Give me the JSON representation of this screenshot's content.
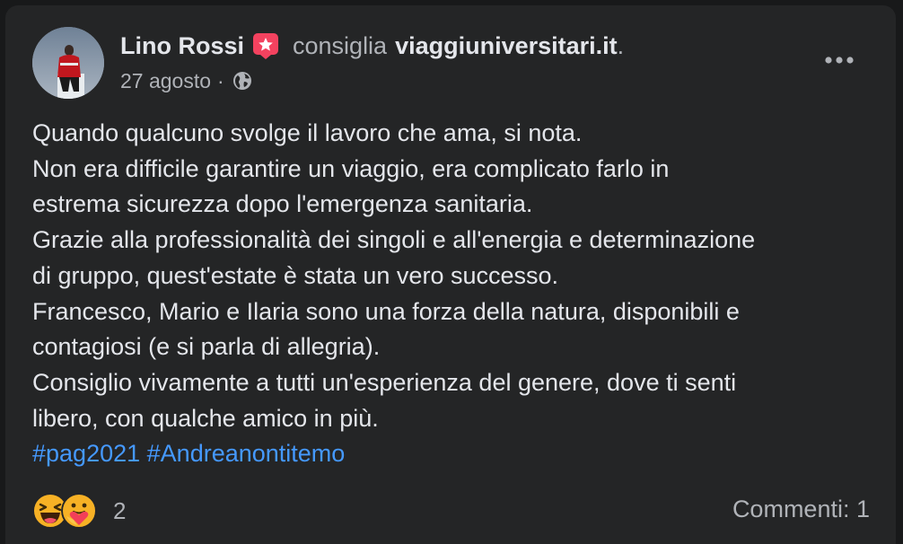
{
  "post": {
    "author": "Lino Rossi",
    "verb": "consiglia",
    "page": "viaggiuniversitari.it",
    "page_suffix": ".",
    "date": "27 agosto",
    "date_separator": "·",
    "privacy_icon": "globe-icon",
    "recommend_icon": "star-badge-icon",
    "more_icon": "more-options-icon",
    "body_lines": [
      "Quando qualcuno svolge il lavoro che ama, si nota.",
      "Non era difficile garantire un viaggio, era complicato farlo in",
      "estrema sicurezza dopo l'emergenza sanitaria.",
      "Grazie alla professionalità dei singoli e all'energia e determinazione",
      "di gruppo, quest'estate è stata un vero successo.",
      "Francesco, Mario e Ilaria sono una forza della natura, disponibili e",
      "contagiosi (e si parla di allegria).",
      "Consiglio vivamente a tutti un'esperienza del genere, dove ti senti",
      "libero, con qualche amico in più."
    ],
    "hashtags": [
      "#pag2021",
      "#Andreanontitemo"
    ]
  },
  "footer": {
    "reactions": [
      "haha-reaction-icon",
      "care-reaction-icon"
    ],
    "reaction_count": "2",
    "comments": "Commenti: 1"
  },
  "colors": {
    "background": "#18191a",
    "card": "#242526",
    "text_primary": "#e4e6eb",
    "text_secondary": "#b0b3b8",
    "hashtag": "#4599ff",
    "badge": "#f3425f"
  }
}
